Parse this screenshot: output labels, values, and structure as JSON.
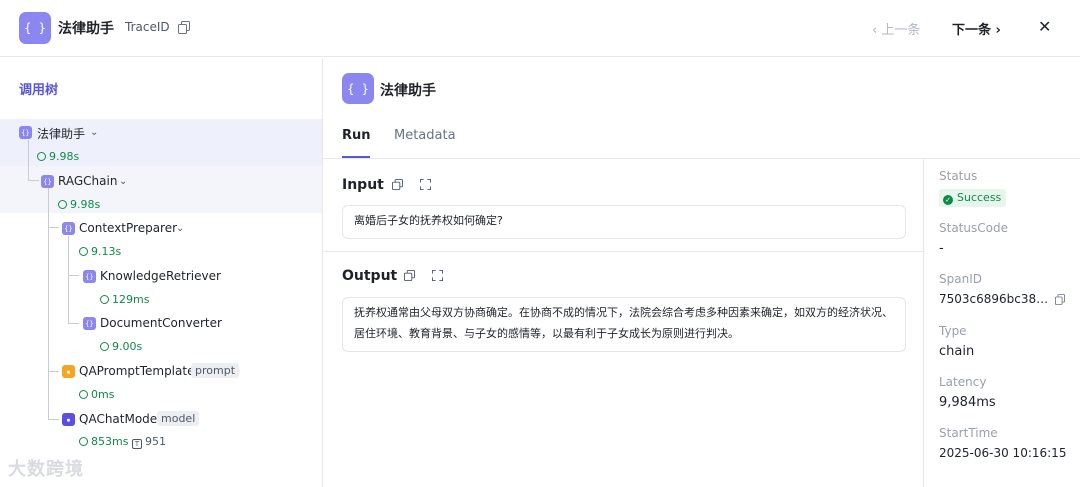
{
  "header": {
    "icon": "braces-icon",
    "title": "法律助手",
    "trace_label": "TraceID",
    "prev_label": "‹ 上一条",
    "next_label": "下一条 ›",
    "close_label": "✕"
  },
  "tree": {
    "title": "调用树",
    "nodes": [
      {
        "name": "法律助手",
        "time": "9.98s"
      },
      {
        "name": "RAGChain",
        "time": "9.98s"
      },
      {
        "name": "ContextPreparer",
        "time": "9.13s"
      },
      {
        "name": "KnowledgeRetriever",
        "time": "129ms"
      },
      {
        "name": "DocumentConverter",
        "time": "9.00s"
      },
      {
        "name": "QAPromptTemplate",
        "tag": "prompt",
        "time": "0ms"
      },
      {
        "name": "QAChatModel",
        "tag": "model",
        "time": "853ms",
        "tokens": "951"
      }
    ]
  },
  "watermark": "大数跨境",
  "main": {
    "title": "法律助手",
    "tabs": [
      "Run",
      "Metadata"
    ],
    "active_tab": "Run",
    "input_title": "Input",
    "input_text": "离婚后子女的抚养权如何确定?",
    "output_title": "Output",
    "output_text": "抚养权通常由父母双方协商确定。在协商不成的情况下，法院会综合考虑多种因素来确定，如双方的经济状况、居住环境、教育背景、与子女的感情等，以最有利于子女成长为原则进行判决。"
  },
  "meta": {
    "status_label": "Status",
    "status_value": "Success",
    "statuscode_label": "StatusCode",
    "statuscode_value": "-",
    "spanid_label": "SpanID",
    "spanid_value": "7503c6896bc38…",
    "type_label": "Type",
    "type_value": "chain",
    "latency_label": "Latency",
    "latency_value": "9,984ms",
    "starttime_label": "StartTime",
    "starttime_value": "2025-06-30 10:16:15"
  },
  "colors": {
    "accent": "#5b56d6",
    "badge": "#8b86f0",
    "success": "#0f8a4a"
  }
}
